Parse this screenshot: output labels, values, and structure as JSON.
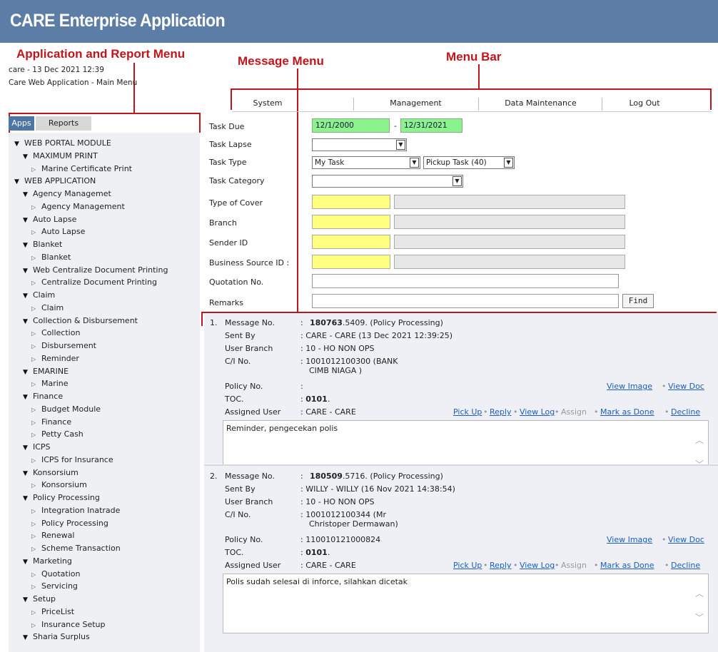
{
  "app": {
    "title": "CARE Enterprise Application"
  },
  "annotations": {
    "app_report_menu": "Application and Report Menu",
    "message_menu": "Message Menu",
    "menu_bar": "Menu Bar"
  },
  "session": {
    "user_line": "care - 13 Dec 2021 12:39",
    "page_line": "Care Web Application - Main Menu"
  },
  "sidebar": {
    "tabs": [
      "Apps",
      "Reports"
    ],
    "tree": [
      {
        "label": "WEB PORTAL MODULE",
        "level": 0,
        "state": "expanded"
      },
      {
        "label": "MAXIMUM PRINT",
        "level": 1,
        "state": "expanded"
      },
      {
        "label": "Marine Certificate Print",
        "level": 2,
        "state": "leaf"
      },
      {
        "label": "WEB APPLICATION",
        "level": 0,
        "state": "expanded"
      },
      {
        "label": "Agency Managemet",
        "level": 1,
        "state": "expanded"
      },
      {
        "label": "Agency Management",
        "level": 2,
        "state": "leaf"
      },
      {
        "label": "Auto Lapse",
        "level": 1,
        "state": "expanded"
      },
      {
        "label": "Auto Lapse",
        "level": 2,
        "state": "leaf"
      },
      {
        "label": "Blanket",
        "level": 1,
        "state": "expanded"
      },
      {
        "label": "Blanket",
        "level": 2,
        "state": "leaf"
      },
      {
        "label": "Web Centralize Document Printing",
        "level": 1,
        "state": "expanded"
      },
      {
        "label": "Centralize Document Printing",
        "level": 2,
        "state": "leaf"
      },
      {
        "label": "Claim",
        "level": 1,
        "state": "expanded"
      },
      {
        "label": "Claim",
        "level": 2,
        "state": "leaf"
      },
      {
        "label": "Collection & Disbursement",
        "level": 1,
        "state": "expanded"
      },
      {
        "label": "Collection",
        "level": 2,
        "state": "leaf"
      },
      {
        "label": "Disbursement",
        "level": 2,
        "state": "leaf"
      },
      {
        "label": "Reminder",
        "level": 2,
        "state": "leaf"
      },
      {
        "label": "EMARINE",
        "level": 1,
        "state": "expanded"
      },
      {
        "label": "Marine",
        "level": 2,
        "state": "leaf"
      },
      {
        "label": "Finance",
        "level": 1,
        "state": "expanded"
      },
      {
        "label": "Budget Module",
        "level": 2,
        "state": "leaf"
      },
      {
        "label": "Finance",
        "level": 2,
        "state": "leaf"
      },
      {
        "label": "Petty Cash",
        "level": 2,
        "state": "leaf"
      },
      {
        "label": "ICPS",
        "level": 1,
        "state": "expanded"
      },
      {
        "label": "ICPS for Insurance",
        "level": 2,
        "state": "leaf"
      },
      {
        "label": "Konsorsium",
        "level": 1,
        "state": "expanded"
      },
      {
        "label": "Konsorsium",
        "level": 2,
        "state": "leaf"
      },
      {
        "label": "Policy Processing",
        "level": 1,
        "state": "expanded"
      },
      {
        "label": "Integration Inatrade",
        "level": 2,
        "state": "leaf"
      },
      {
        "label": "Policy Processing",
        "level": 2,
        "state": "leaf"
      },
      {
        "label": "Renewal",
        "level": 2,
        "state": "leaf"
      },
      {
        "label": "Scheme Transaction",
        "level": 2,
        "state": "leaf"
      },
      {
        "label": "Marketing",
        "level": 1,
        "state": "expanded"
      },
      {
        "label": "Quotation",
        "level": 2,
        "state": "leaf"
      },
      {
        "label": "Servicing",
        "level": 2,
        "state": "leaf"
      },
      {
        "label": "Setup",
        "level": 1,
        "state": "expanded"
      },
      {
        "label": "PriceList",
        "level": 2,
        "state": "leaf"
      },
      {
        "label": "Insurance Setup",
        "level": 2,
        "state": "leaf"
      },
      {
        "label": "Sharia Surplus",
        "level": 1,
        "state": "expanded"
      }
    ]
  },
  "menubar": {
    "items": [
      "System",
      "Management",
      "Data Maintenance",
      "Log Out"
    ]
  },
  "filter": {
    "task_due_label": "Task Due",
    "task_due_from": "12/1/2000",
    "task_due_sep": "-",
    "task_due_to": "12/31/2021",
    "task_lapse_label": "Task Lapse",
    "task_lapse_value": "",
    "task_type_label": "Task Type",
    "task_type_value": "My Task",
    "pickup_value": "Pickup Task (40)",
    "task_category_label": "Task Category",
    "task_category_value": "",
    "type_of_cover_label": "Type of Cover",
    "branch_label": "Branch",
    "sender_id_label": "Sender ID",
    "business_source_label": "Business Source ID :",
    "quotation_label": "Quotation No.",
    "remarks_label": "Remarks",
    "find_label": "Find"
  },
  "labels": {
    "message_no": "Message No.",
    "sent_by": "Sent By",
    "user_branch": "User Branch",
    "ci_no": "C/I No.",
    "policy_no": "Policy No.",
    "toc": "TOC.",
    "assigned_user": "Assigned User",
    "colon": ":",
    "view_image": "View Image",
    "view_doc": "View Doc",
    "pick_up": "Pick Up",
    "reply": "Reply",
    "view_log": "View Log",
    "assign": "Assign",
    "mark_done": "Mark as Done",
    "decline": "Decline",
    "dot": "•"
  },
  "messages": [
    {
      "index": "1.",
      "msg_no_bold": "180763",
      "msg_no_rest": ".5409. (Policy Processing)",
      "sent_by": ": CARE - CARE (13 Dec 2021 12:39:25)",
      "user_branch": ": 10 - HO NON OPS",
      "ci_line1": ": 1001012100300 (BANK",
      "ci_line2": "CIMB NIAGA )",
      "policy_no": ":",
      "toc_bold": "0101",
      "toc_rest": ".",
      "assigned_user": ": CARE - CARE",
      "remark": "Reminder, pengecekan polis"
    },
    {
      "index": "2.",
      "msg_no_bold": "180509",
      "msg_no_rest": ".5716. (Policy Processing)",
      "sent_by": ": WILLY - WILLY (16 Nov 2021 14:38:54)",
      "user_branch": ": 10 - HO NON OPS",
      "ci_line1": ": 1001012100344 (Mr",
      "ci_line2": "Christoper Dermawan)",
      "policy_no": ": 110010121000824",
      "toc_bold": "0101",
      "toc_rest": ".",
      "assigned_user": ": CARE - CARE",
      "remark": "Polis sudah selesai di inforce, silahkan dicetak"
    }
  ],
  "colors": {
    "banner": "#5c7ea6",
    "annotation": "#c0161b",
    "link": "#1a5ebf",
    "date_field": "#8cf28c",
    "lookup_field": "#ffff80"
  }
}
